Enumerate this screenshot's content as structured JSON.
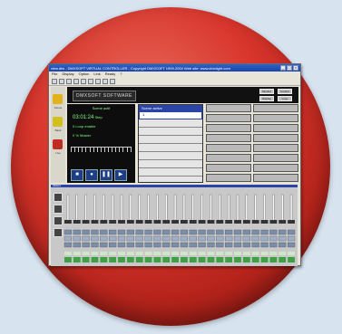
{
  "window": {
    "title": "view.dtw - DMXSOFT VIRTUAL CONTROLLER - Copyright DMXSOFT 1999-2004    Web site: www.dmxlight.com",
    "menu": [
      "File",
      "Display",
      "Option",
      "Link",
      "Ready",
      "?"
    ]
  },
  "left_panel": {
    "items": [
      {
        "label": "Scene",
        "color": "#e1b21b",
        "icon": "folder-icon"
      },
      {
        "label": "Bank",
        "color": "#d1c01e",
        "icon": "chart-icon"
      },
      {
        "label": "Live",
        "color": "#c22a24",
        "icon": "lightning-icon"
      }
    ]
  },
  "banner": {
    "logo_text": "DMXSOFT SOFTWARE",
    "buttons": [
      "Monitor",
      "Control",
      "Display",
      "Loop"
    ]
  },
  "player": {
    "title": "Scene actif",
    "time": "03:01:24",
    "label_sequence": "Step",
    "line2": "0  Loop enable",
    "line3": "0  % Master"
  },
  "scene_list": {
    "header": "Scene active",
    "selected": "1"
  },
  "mixer": {
    "title": "Sliders",
    "channel_count": 26
  }
}
